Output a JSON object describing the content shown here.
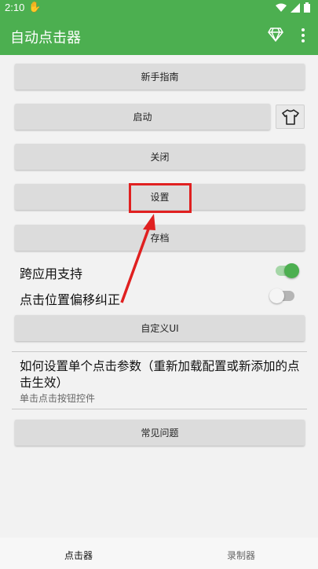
{
  "status_bar": {
    "time": "2:10",
    "icons": [
      "hand-icon",
      "wifi-icon",
      "signal-icon",
      "battery-icon"
    ]
  },
  "app_bar": {
    "title": "自动点击器",
    "icons": [
      "diamond-icon",
      "more-vert-icon"
    ]
  },
  "buttons": {
    "guide": "新手指南",
    "start": "启动",
    "close": "关闭",
    "settings": "设置",
    "archive": "存档",
    "custom_ui": "自定义UI",
    "faq": "常见问题"
  },
  "toggles": {
    "cross_app": {
      "label": "跨应用支持",
      "on": true
    },
    "offset_fix": {
      "label": "点击位置偏移纠正",
      "on": false
    }
  },
  "faq_item": {
    "title": "如何设置单个点击参数（重新加载配置或新添加的点击生效）",
    "subtitle": "单击点击按钮控件"
  },
  "bottom_nav": {
    "clicker": "点击器",
    "recorder": "录制器",
    "active": "clicker"
  },
  "colors": {
    "primary": "#4caf50",
    "toggle_on_thumb": "#4caf50",
    "toggle_on_track": "#a5d6a7",
    "annotation": "#e02020"
  }
}
